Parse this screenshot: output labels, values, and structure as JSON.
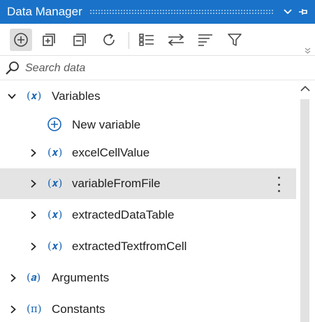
{
  "panel": {
    "title": "Data Manager",
    "accent_color": "#1a73c9",
    "title_buttons": [
      {
        "name": "collapse",
        "icon": "chevron-down-icon"
      },
      {
        "name": "pin",
        "icon": "pin-icon"
      }
    ]
  },
  "toolbar": {
    "buttons": [
      {
        "name": "add",
        "icon": "circle-plus-icon",
        "active": true
      },
      {
        "name": "expand-all",
        "icon": "square-plus-icon"
      },
      {
        "name": "collapse-all",
        "icon": "square-minus-icon"
      },
      {
        "name": "refresh",
        "icon": "refresh-icon"
      },
      {
        "name": "list-view",
        "icon": "list-icon"
      },
      {
        "name": "swap",
        "icon": "swap-arrows-icon"
      },
      {
        "name": "sort",
        "icon": "sort-lines-icon"
      },
      {
        "name": "filter",
        "icon": "filter-icon"
      }
    ],
    "overflow_icon": "double-chevron-down-icon"
  },
  "search": {
    "placeholder": "Search data",
    "value": ""
  },
  "tree": {
    "variables": {
      "label": "Variables",
      "icon_symbol": "(𝒙)",
      "expanded": true,
      "new_item_label": "New variable",
      "children": [
        {
          "label": "excelCellValue",
          "icon_symbol": "(𝒙)"
        },
        {
          "label": "variableFromFile",
          "icon_symbol": "(𝒙)",
          "selected": true
        },
        {
          "label": "extractedDataTable",
          "icon_symbol": "(𝒙)"
        },
        {
          "label": "extractedTextfromCell",
          "icon_symbol": "(𝒙)"
        }
      ]
    },
    "arguments": {
      "label": "Arguments",
      "icon_symbol": "(𝒂)",
      "expanded": false
    },
    "constants": {
      "label": "Constants",
      "icon_symbol": "(π)",
      "expanded": false
    }
  }
}
